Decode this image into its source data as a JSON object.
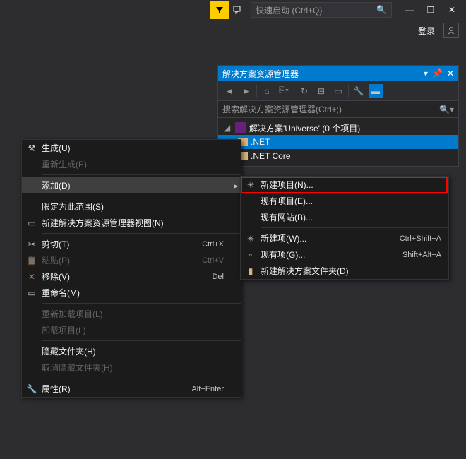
{
  "titlebar": {
    "quick_launch_placeholder": "快速启动 (Ctrl+Q)"
  },
  "login": {
    "label": "登录"
  },
  "panel": {
    "title": "解决方案资源管理器",
    "search_placeholder": "搜索解决方案资源管理器(Ctrl+;)",
    "solution_label": "解决方案'Universe' (0 个项目)",
    "item_net": ".NET",
    "item_netcore": ".NET Core"
  },
  "ctx1": {
    "build": "生成(U)",
    "rebuild": "重新生成(E)",
    "add": "添加(D)",
    "scope": "限定为此范围(S)",
    "newview": "新建解决方案资源管理器视图(N)",
    "cut": "剪切(T)",
    "cut_sc": "Ctrl+X",
    "paste": "粘贴(P)",
    "paste_sc": "Ctrl+V",
    "remove": "移除(V)",
    "remove_sc": "Del",
    "rename": "重命名(M)",
    "reload": "重新加载项目(L)",
    "unload": "卸载项目(L)",
    "hidefolder": "隐藏文件夹(H)",
    "unhidefolder": "取消隐藏文件夹(H)",
    "props": "属性(R)",
    "props_sc": "Alt+Enter"
  },
  "ctx2": {
    "newproj": "新建项目(N)...",
    "existproj": "现有项目(E)...",
    "existsite": "现有网站(B)...",
    "newitem": "新建项(W)...",
    "newitem_sc": "Ctrl+Shift+A",
    "existitem": "现有项(G)...",
    "existitem_sc": "Shift+Alt+A",
    "newfolder": "新建解决方案文件夹(D)"
  }
}
